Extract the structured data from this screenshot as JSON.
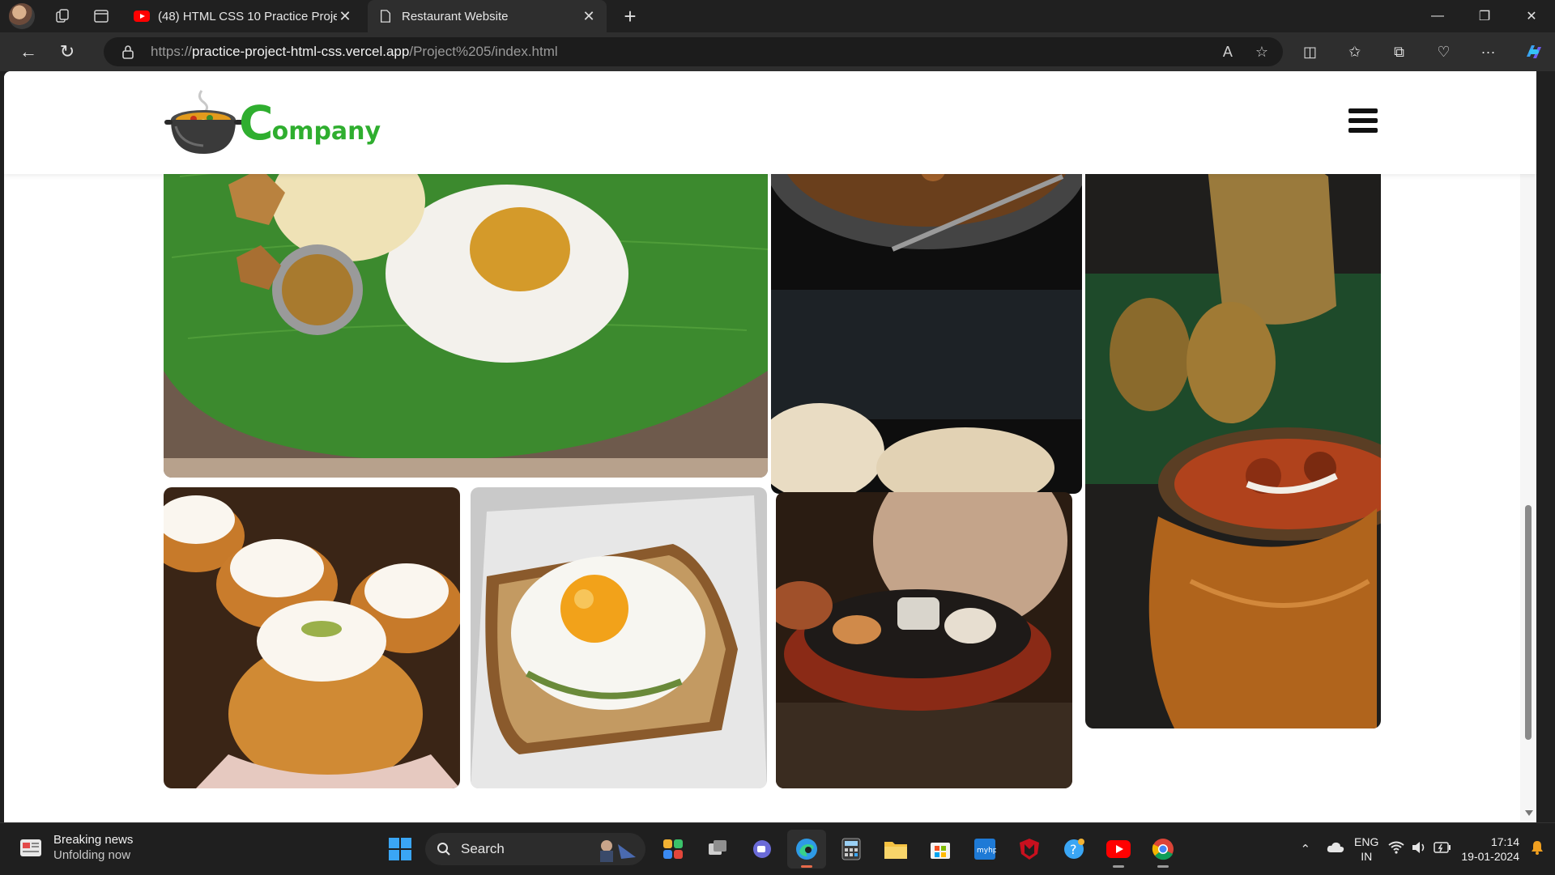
{
  "browser": {
    "tabs": [
      {
        "title": "(48) HTML CSS 10 Practice Projec",
        "favicon": "youtube-icon",
        "active": false
      },
      {
        "title": "Restaurant Website",
        "favicon": "page-icon",
        "active": true
      }
    ],
    "address": {
      "scheme": "https://",
      "host": "practice-project-html-css.vercel.app",
      "path": "/Project%205/index.html"
    }
  },
  "site": {
    "logo_initial": "C",
    "logo_rest": "ompany",
    "brand_color": "#2fae2f",
    "gallery": [
      {
        "name": "banana-leaf-meal",
        "icon": "food-photo"
      },
      {
        "name": "pan-curry-naan",
        "icon": "food-photo"
      },
      {
        "name": "copper-curry-pot",
        "icon": "food-photo"
      },
      {
        "name": "cream-cupcakes",
        "icon": "food-photo"
      },
      {
        "name": "egg-on-toast",
        "icon": "food-photo"
      },
      {
        "name": "sizzler-momos",
        "icon": "food-photo"
      }
    ]
  },
  "taskbar": {
    "news_title": "Breaking news",
    "news_subtitle": "Unfolding now",
    "search_label": "Search",
    "lang_line1": "ENG",
    "lang_line2": "IN",
    "time": "17:14",
    "date": "19-01-2024"
  }
}
